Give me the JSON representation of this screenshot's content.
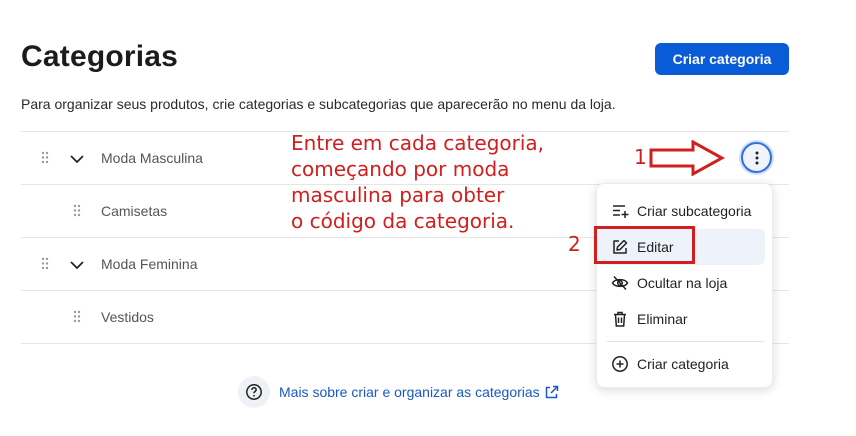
{
  "header": {
    "title": "Categorias",
    "create_button": "Criar categoria",
    "subtitle": "Para organizar seus produtos, crie categorias e subcategorias que aparecerão no menu da loja."
  },
  "categories": [
    {
      "label": "Moda Masculina",
      "level": "parent",
      "expanded": true
    },
    {
      "label": "Camisetas",
      "level": "child"
    },
    {
      "label": "Moda Feminina",
      "level": "parent",
      "expanded": true
    },
    {
      "label": "Vestidos",
      "level": "child"
    }
  ],
  "menu": {
    "items": [
      {
        "label": "Criar subcategoria",
        "icon": "list-add-icon"
      },
      {
        "label": "Editar",
        "icon": "edit-icon"
      },
      {
        "label": "Ocultar na loja",
        "icon": "eye-off-icon"
      },
      {
        "label": "Eliminar",
        "icon": "trash-icon"
      },
      {
        "label": "Criar categoria",
        "icon": "plus-circle-icon"
      }
    ]
  },
  "help": {
    "link_text": "Mais sobre criar e organizar as categorias"
  },
  "annotation": {
    "lines": [
      "Entre em cada categoria,",
      "começando por moda",
      "masculina para obter",
      "o código da categoria."
    ],
    "step1": "1",
    "step2": "2"
  },
  "colors": {
    "primary": "#0a5bd8",
    "link": "#1a58c9",
    "annotation": "#d01f1f"
  }
}
